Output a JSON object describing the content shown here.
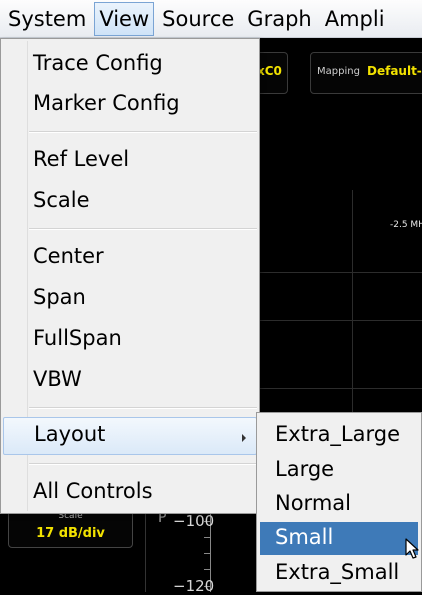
{
  "menubar": {
    "items": [
      {
        "label": "System"
      },
      {
        "label": "View"
      },
      {
        "label": "Source"
      },
      {
        "label": "Graph"
      },
      {
        "label": "Ampli"
      }
    ]
  },
  "background": {
    "left_chip_value": "xC0",
    "mapping_label": "Mapping",
    "mapping_value": "Default-",
    "freq_label": "-2.5 MH",
    "scale_label": "Scale",
    "scale_value": "17 dB/div",
    "axis_ticks": [
      "−100",
      "−120"
    ],
    "axis_letter": "P"
  },
  "view_menu": {
    "items": [
      {
        "label": "Trace Config"
      },
      {
        "label": "Marker Config"
      },
      {
        "label": "Ref Level"
      },
      {
        "label": "Scale"
      },
      {
        "label": "Center"
      },
      {
        "label": "Span"
      },
      {
        "label": "FullSpan"
      },
      {
        "label": "VBW"
      },
      {
        "label": "Layout"
      },
      {
        "label": "All Controls"
      }
    ]
  },
  "layout_submenu": {
    "items": [
      {
        "label": "Extra_Large"
      },
      {
        "label": "Large"
      },
      {
        "label": "Normal"
      },
      {
        "label": "Small"
      },
      {
        "label": "Extra_Small"
      }
    ],
    "selected": "Small"
  },
  "colors": {
    "accent_yellow": "#f2e200",
    "selection_blue": "#3e7ab8"
  }
}
